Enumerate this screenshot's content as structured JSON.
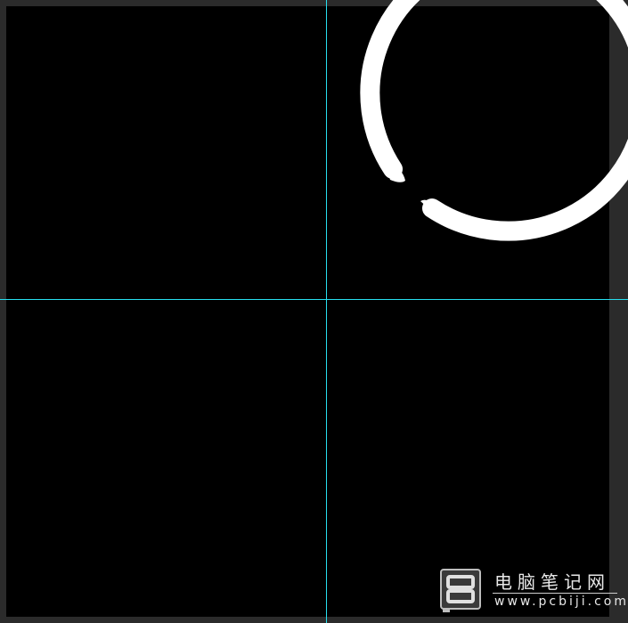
{
  "colors": {
    "workspace": "#2b2b2b",
    "canvas": "#000000",
    "guide": "#27e0f0",
    "ring": "#ffffff"
  },
  "watermark": {
    "title": "电脑笔记网",
    "url": "www.pcbiji.com"
  }
}
